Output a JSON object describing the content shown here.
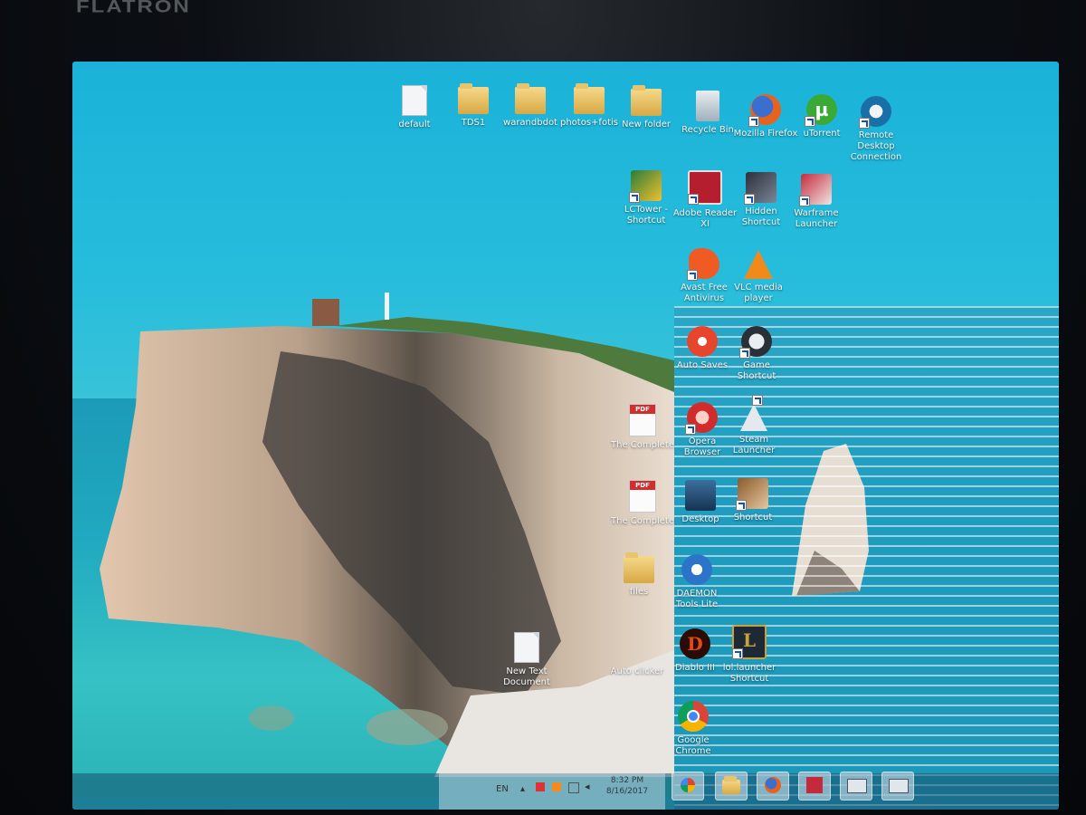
{
  "monitor": {
    "brand": "FLATRON"
  },
  "desktop_icons": [
    {
      "id": "default",
      "label": "default",
      "kind": "doc"
    },
    {
      "id": "tds",
      "label": "TDS1",
      "kind": "folder"
    },
    {
      "id": "warandbdot",
      "label": "warandbdot",
      "kind": "folder"
    },
    {
      "id": "photos",
      "label": "photos+fotis",
      "kind": "folder"
    },
    {
      "id": "newfolder",
      "label": "New folder",
      "kind": "folder"
    },
    {
      "id": "recycle",
      "label": "Recycle Bin",
      "kind": "recycle"
    },
    {
      "id": "firefox",
      "label": "Mozilla Firefox",
      "kind": "firefox"
    },
    {
      "id": "utorrent",
      "label": "uTorrent",
      "kind": "utorrent"
    },
    {
      "id": "remote",
      "label": "Remote Desktop Connection",
      "kind": "remote"
    },
    {
      "id": "lctower",
      "label": "LCTower - Shortcut",
      "kind": "lctower"
    },
    {
      "id": "adobe",
      "label": "Adobe Reader XI",
      "kind": "adobe"
    },
    {
      "id": "hidden",
      "label": "Hidden Shortcut",
      "kind": "hidden"
    },
    {
      "id": "warframe",
      "label": "Warframe Launcher",
      "kind": "warframe"
    },
    {
      "id": "avast",
      "label": "Avast Free Antivirus",
      "kind": "avast"
    },
    {
      "id": "vlc",
      "label": "VLC media player",
      "kind": "vlc"
    },
    {
      "id": "autosaves",
      "label": "Auto Saves",
      "kind": "autosaves"
    },
    {
      "id": "game",
      "label": "Game Shortcut",
      "kind": "game"
    },
    {
      "id": "pdf1",
      "label": "The Complete",
      "kind": "pdf"
    },
    {
      "id": "pdf2",
      "label": "The Complete",
      "kind": "pdf"
    },
    {
      "id": "opera",
      "label": "Opera Browser",
      "kind": "opera"
    },
    {
      "id": "steam",
      "label": "Steam Launcher",
      "kind": "steam"
    },
    {
      "id": "folder2",
      "label": "files",
      "kind": "folder"
    },
    {
      "id": "desk1",
      "label": "Desktop",
      "kind": "desk"
    },
    {
      "id": "desk2",
      "label": "Shortcut",
      "kind": "desk2"
    },
    {
      "id": "daemon",
      "label": "DAEMON Tools Lite",
      "kind": "daemon"
    },
    {
      "id": "newtext",
      "label": "New Text Document",
      "kind": "doc"
    },
    {
      "id": "autoclicker",
      "label": "Auto clicker",
      "kind": "blank"
    },
    {
      "id": "diablo",
      "label": "Diablo III",
      "kind": "diablo"
    },
    {
      "id": "lol",
      "label": "lol.launcher Shortcut",
      "kind": "lol"
    },
    {
      "id": "chrome",
      "label": "Google Chrome",
      "kind": "chrome"
    }
  ],
  "taskbar": {
    "language": "EN",
    "clock_time": "8:32 PM",
    "clock_date": "8/16/2017"
  }
}
